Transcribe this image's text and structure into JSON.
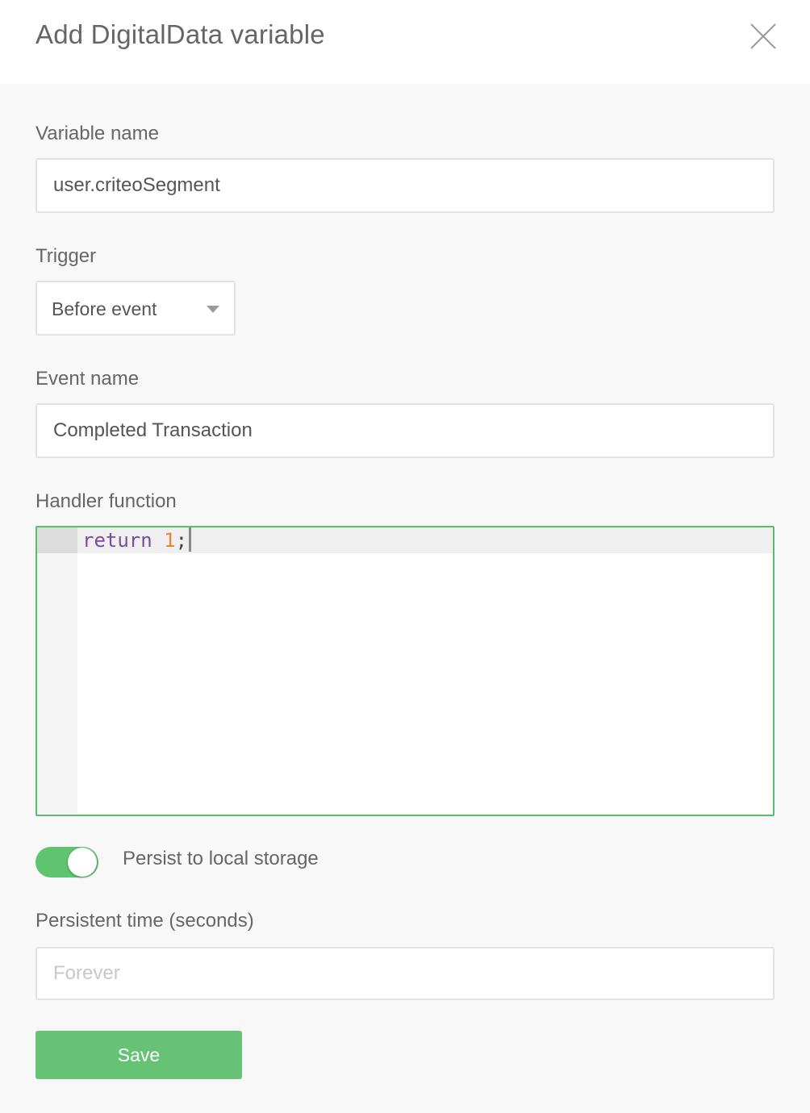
{
  "dialog": {
    "title": "Add DigitalData variable",
    "close_icon": "close-icon"
  },
  "fields": {
    "variable_name": {
      "label": "Variable name",
      "value": "user.criteoSegment"
    },
    "trigger": {
      "label": "Trigger",
      "selected": "Before event",
      "icon": "chevron-down-icon"
    },
    "event_name": {
      "label": "Event name",
      "value": "Completed Transaction"
    },
    "handler": {
      "label": "Handler function",
      "code": {
        "keyword": "return",
        "number": "1",
        "punct": ";"
      },
      "border_color": "#5bbd6a"
    },
    "persist": {
      "label": "Persist to local storage",
      "enabled": true,
      "color": "#5ec46f"
    },
    "persistent_time": {
      "label": "Persistent time (seconds)",
      "value": "",
      "placeholder": "Forever"
    }
  },
  "actions": {
    "save_label": "Save",
    "save_color": "#66c274"
  }
}
